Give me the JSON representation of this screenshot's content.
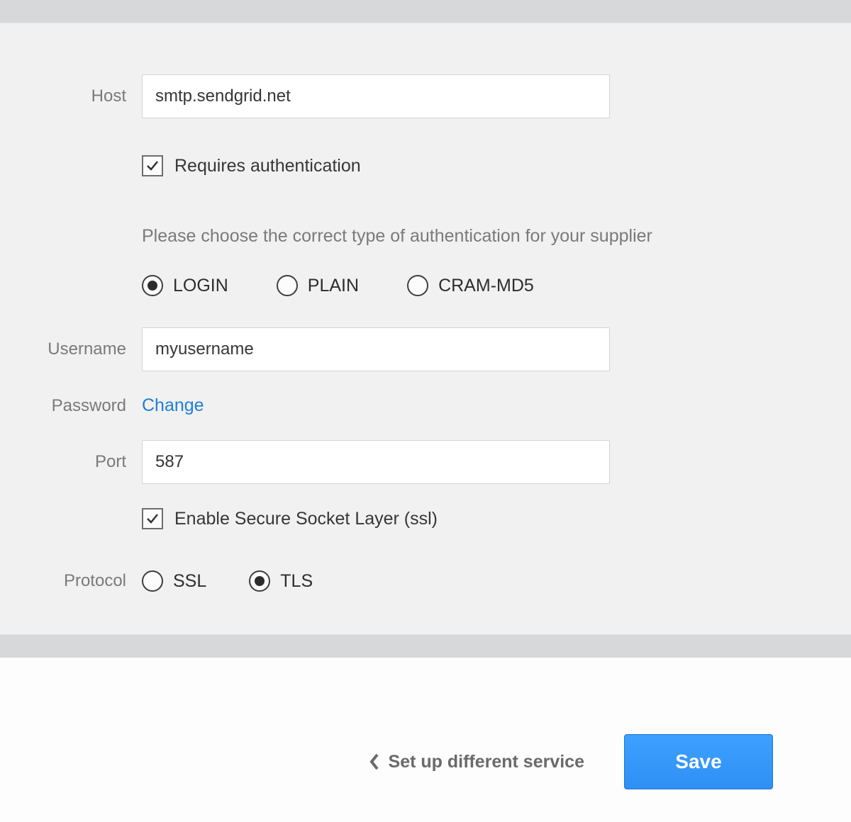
{
  "form": {
    "host_label": "Host",
    "host_value": "smtp.sendgrid.net",
    "requires_auth_label": "Requires authentication",
    "requires_auth_checked": true,
    "auth_helper": "Please choose the correct type of authentication for your supplier",
    "auth_types": {
      "login": "LOGIN",
      "plain": "PLAIN",
      "cram": "CRAM-MD5",
      "selected": "LOGIN"
    },
    "username_label": "Username",
    "username_value": "myusername",
    "password_label": "Password",
    "password_change": "Change",
    "port_label": "Port",
    "port_value": "587",
    "ssl_enable_label": "Enable Secure Socket Layer (ssl)",
    "ssl_enable_checked": true,
    "protocol_label": "Protocol",
    "protocol": {
      "ssl": "SSL",
      "tls": "TLS",
      "selected": "TLS"
    }
  },
  "footer": {
    "back_label": "Set up different service",
    "save_label": "Save"
  }
}
